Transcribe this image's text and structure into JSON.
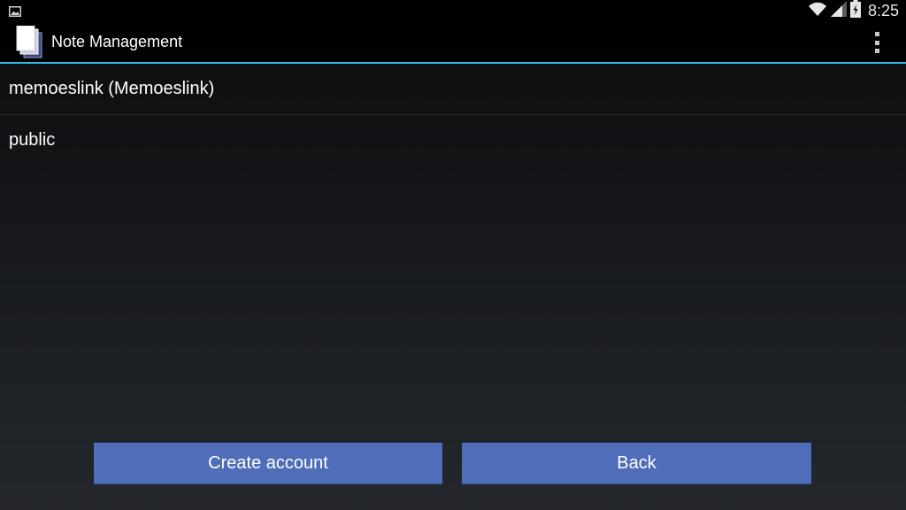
{
  "status_bar": {
    "time": "8:25",
    "icons": [
      "picture-icon",
      "wifi-icon",
      "cell-signal-icon",
      "battery-icon"
    ]
  },
  "action_bar": {
    "title": "Note Management",
    "app_icon": "notes-stack-icon",
    "menu_icon": "overflow-menu-icon",
    "underline_color": "#33b5e5"
  },
  "accounts": {
    "items": [
      {
        "label": "memoeslink (Memoeslink)"
      },
      {
        "label": "public"
      }
    ]
  },
  "buttons": {
    "create_label": "Create account",
    "back_label": "Back",
    "color": "#4f6db8"
  }
}
